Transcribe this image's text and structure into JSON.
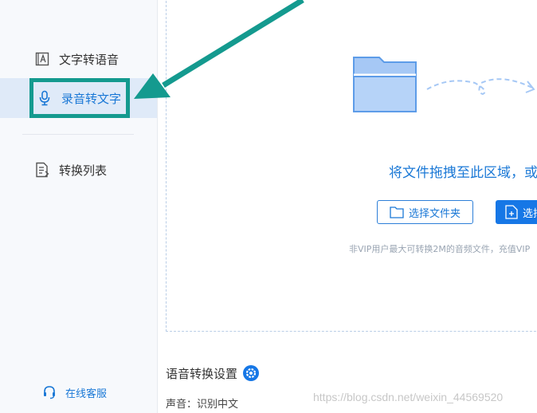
{
  "sidebar": {
    "items": [
      {
        "label": "文字转语音",
        "icon": "text-doc-icon"
      },
      {
        "label": "录音转文字",
        "icon": "microphone-icon",
        "active": true
      },
      {
        "label": "转换列表",
        "icon": "list-doc-icon"
      }
    ],
    "service_label": "在线客服",
    "service_icon": "headset-icon"
  },
  "dropzone": {
    "text": "将文件拖拽至此区域，或",
    "select_folder_label": "选择文件夹",
    "select_file_label": "选择文件",
    "hint": "非VIP用户最大可转换2M的音频文件，充值VIP"
  },
  "settings": {
    "title": "语音转换设置",
    "voice_label": "声音：",
    "voice_value": "识别中文"
  },
  "watermark": "https://blog.csdn.net/weixin_44569520",
  "colors": {
    "accent": "#1a78d6",
    "highlight_border": "#149a8f",
    "active_bg": "#dfeaf8"
  }
}
